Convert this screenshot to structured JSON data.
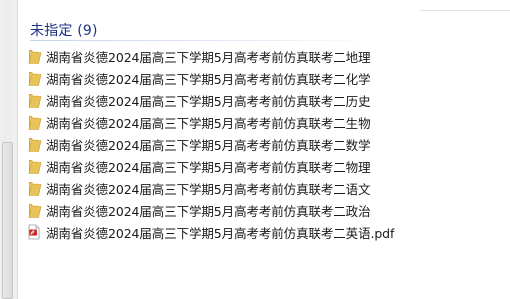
{
  "group": {
    "title": "未指定 (9)"
  },
  "files": [
    {
      "name": "湖南省炎德2024届高三下学期5月高考考前仿真联考二地理",
      "icon": "folder-icon"
    },
    {
      "name": "湖南省炎德2024届高三下学期5月高考考前仿真联考二化学",
      "icon": "folder-icon"
    },
    {
      "name": "湖南省炎德2024届高三下学期5月高考考前仿真联考二历史",
      "icon": "folder-icon"
    },
    {
      "name": "湖南省炎德2024届高三下学期5月高考考前仿真联考二生物",
      "icon": "folder-icon"
    },
    {
      "name": "湖南省炎德2024届高三下学期5月高考考前仿真联考二数学",
      "icon": "folder-icon"
    },
    {
      "name": "湖南省炎德2024届高三下学期5月高考考前仿真联考二物理",
      "icon": "folder-icon"
    },
    {
      "name": "湖南省炎德2024届高三下学期5月高考考前仿真联考二语文",
      "icon": "folder-icon"
    },
    {
      "name": "湖南省炎德2024届高三下学期5月高考考前仿真联考二政治",
      "icon": "folder-icon"
    },
    {
      "name": "湖南省炎德2024届高三下学期5月高考考前仿真联考二英语.pdf",
      "icon": "pdf-file-icon"
    }
  ],
  "colors": {
    "group_title": "#1e3287",
    "folder": "#e8c35a",
    "pdf_red": "#c8201e"
  }
}
